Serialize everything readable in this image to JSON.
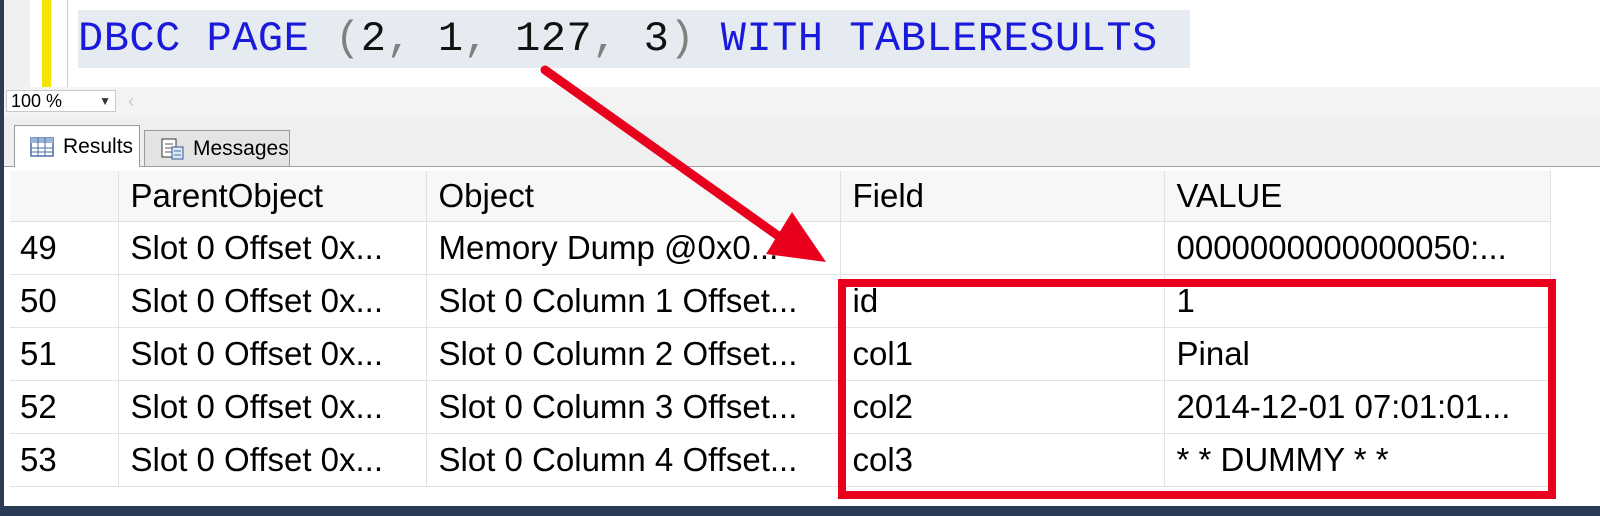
{
  "editor": {
    "sql_tokens": [
      {
        "text": "DBCC PAGE",
        "kind": "kw"
      },
      {
        "text": " ",
        "kind": "pun"
      },
      {
        "text": "(",
        "kind": "pun"
      },
      {
        "text": "2",
        "kind": "num"
      },
      {
        "text": ", ",
        "kind": "pun"
      },
      {
        "text": "1",
        "kind": "num"
      },
      {
        "text": ", ",
        "kind": "pun"
      },
      {
        "text": "127",
        "kind": "num"
      },
      {
        "text": ", ",
        "kind": "pun"
      },
      {
        "text": "3",
        "kind": "num"
      },
      {
        "text": ")",
        "kind": "pun"
      },
      {
        "text": " WITH TABLERESULTS",
        "kind": "kw"
      }
    ]
  },
  "zoom": {
    "value": "100 %"
  },
  "tabs": [
    {
      "label": "Results",
      "icon": "grid-icon",
      "active": true
    },
    {
      "label": "Messages",
      "icon": "document-icon",
      "active": false
    }
  ],
  "grid": {
    "columns": [
      "",
      "ParentObject",
      "Object",
      "Field",
      "VALUE"
    ],
    "rows": [
      [
        "49",
        "Slot 0 Offset 0x...",
        "Memory Dump @0x0...",
        "",
        "0000000000000050:..."
      ],
      [
        "50",
        "Slot 0 Offset 0x...",
        "Slot 0 Column 1 Offset...",
        "id",
        "1"
      ],
      [
        "51",
        "Slot 0 Offset 0x...",
        "Slot 0 Column 2 Offset...",
        "col1",
        "Pinal"
      ],
      [
        "52",
        "Slot 0 Offset 0x...",
        "Slot 0 Column 3 Offset...",
        "col2",
        "2014-12-01 07:01:01..."
      ],
      [
        "53",
        "Slot 0 Offset 0x...",
        "Slot 0 Column 4 Offset...",
        "col3",
        "* * DUMMY * *"
      ]
    ]
  },
  "colors": {
    "keyword": "#1a1adc",
    "annotation": "#e8001c",
    "change_bar": "#f5e400"
  }
}
